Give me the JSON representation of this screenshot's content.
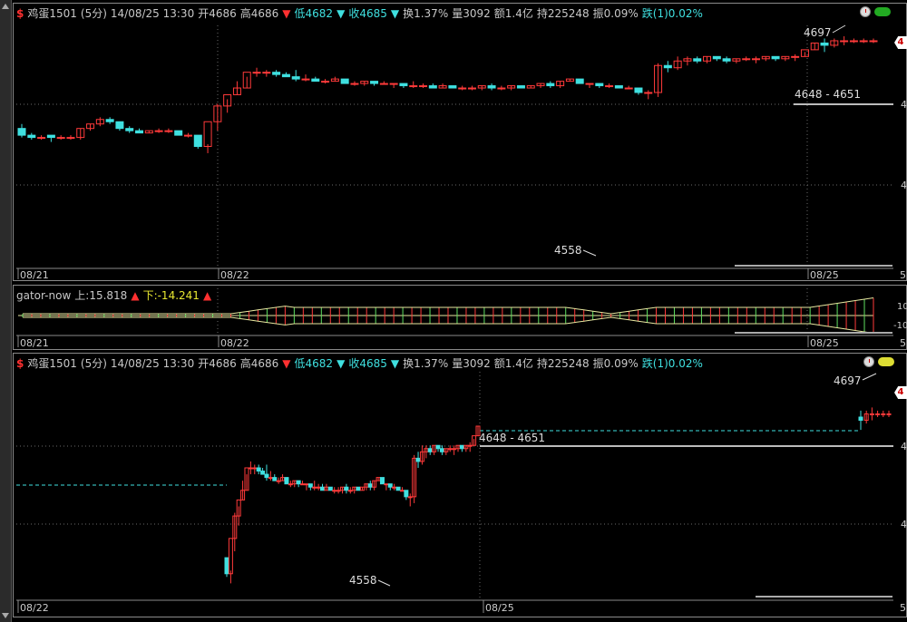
{
  "header": {
    "symbol_mark": "$",
    "name": "鸡蛋1501",
    "period": "(5分)",
    "datetime": "14/08/25 13:30",
    "open": "开4686",
    "high": "高4686",
    "low": "低4682",
    "close": "收4685",
    "turnover": "换1.37%",
    "volume": "量3092",
    "amount": "额1.4亿",
    "open_interest": "持225248",
    "amplitude": "振0.09%",
    "change": "跌(1)0.02%"
  },
  "indicator": {
    "name": "gator-now",
    "upper": "上:15.818",
    "lower": "下:-14.241",
    "scale_top": "10",
    "scale_bottom": "-10"
  },
  "colors": {
    "up": "#ff3a3a",
    "down": "#3fe0e0",
    "grid": "#6a6a6a",
    "bg": "#000000",
    "gator_line": "#e8e8a0",
    "gator_red": "#ff3a3a",
    "gator_green": "#60e060"
  },
  "right_tag": "4",
  "chart_data": [
    {
      "type": "candlestick",
      "title": "鸡蛋1501 (5分)",
      "x_labels": [
        "08/21",
        "08/22",
        "08/25"
      ],
      "right_axis_ticks": [
        "4",
        "4",
        "4"
      ],
      "annotations": {
        "high_label": "4697",
        "low_label": "4558",
        "range_label": "4648 - 4651",
        "right_edge": "5"
      },
      "ohlc_rel": [
        [
          0.59,
          0.61,
          0.55,
          0.56
        ],
        [
          0.56,
          0.57,
          0.54,
          0.55
        ],
        [
          0.55,
          0.56,
          0.54,
          0.55
        ],
        [
          0.56,
          0.56,
          0.53,
          0.55
        ],
        [
          0.55,
          0.56,
          0.54,
          0.55
        ],
        [
          0.55,
          0.56,
          0.54,
          0.55
        ],
        [
          0.55,
          0.59,
          0.54,
          0.59
        ],
        [
          0.59,
          0.61,
          0.58,
          0.61
        ],
        [
          0.61,
          0.64,
          0.6,
          0.63
        ],
        [
          0.63,
          0.64,
          0.61,
          0.62
        ],
        [
          0.62,
          0.62,
          0.58,
          0.59
        ],
        [
          0.59,
          0.6,
          0.57,
          0.58
        ],
        [
          0.58,
          0.59,
          0.57,
          0.57
        ],
        [
          0.57,
          0.58,
          0.57,
          0.58
        ],
        [
          0.58,
          0.59,
          0.57,
          0.58
        ],
        [
          0.58,
          0.59,
          0.57,
          0.58
        ],
        [
          0.58,
          0.58,
          0.56,
          0.56
        ],
        [
          0.56,
          0.57,
          0.55,
          0.56
        ],
        [
          0.56,
          0.56,
          0.5,
          0.51
        ],
        [
          0.51,
          0.52,
          0.48,
          0.62
        ],
        [
          0.62,
          0.7,
          0.58,
          0.69
        ],
        [
          0.69,
          0.72,
          0.66,
          0.74
        ],
        [
          0.74,
          0.8,
          0.74,
          0.77
        ],
        [
          0.77,
          0.82,
          0.77,
          0.84
        ],
        [
          0.84,
          0.86,
          0.82,
          0.84
        ],
        [
          0.84,
          0.85,
          0.82,
          0.84
        ],
        [
          0.84,
          0.85,
          0.82,
          0.83
        ],
        [
          0.83,
          0.84,
          0.82,
          0.82
        ],
        [
          0.82,
          0.85,
          0.8,
          0.81
        ],
        [
          0.81,
          0.83,
          0.8,
          0.81
        ],
        [
          0.81,
          0.82,
          0.8,
          0.8
        ],
        [
          0.8,
          0.81,
          0.79,
          0.8
        ],
        [
          0.8,
          0.82,
          0.8,
          0.81
        ],
        [
          0.81,
          0.81,
          0.79,
          0.79
        ],
        [
          0.79,
          0.8,
          0.78,
          0.79
        ],
        [
          0.79,
          0.8,
          0.78,
          0.8
        ],
        [
          0.8,
          0.8,
          0.78,
          0.79
        ],
        [
          0.79,
          0.8,
          0.79,
          0.79
        ],
        [
          0.79,
          0.79,
          0.77,
          0.79
        ],
        [
          0.79,
          0.79,
          0.77,
          0.78
        ],
        [
          0.78,
          0.8,
          0.77,
          0.78
        ],
        [
          0.78,
          0.79,
          0.77,
          0.78
        ],
        [
          0.78,
          0.79,
          0.77,
          0.77
        ],
        [
          0.77,
          0.79,
          0.77,
          0.78
        ],
        [
          0.78,
          0.78,
          0.77,
          0.77
        ],
        [
          0.77,
          0.78,
          0.76,
          0.77
        ],
        [
          0.77,
          0.78,
          0.76,
          0.77
        ],
        [
          0.77,
          0.78,
          0.76,
          0.78
        ],
        [
          0.78,
          0.79,
          0.76,
          0.77
        ],
        [
          0.77,
          0.78,
          0.76,
          0.77
        ],
        [
          0.77,
          0.78,
          0.76,
          0.78
        ],
        [
          0.78,
          0.78,
          0.77,
          0.77
        ],
        [
          0.77,
          0.78,
          0.77,
          0.78
        ],
        [
          0.78,
          0.79,
          0.77,
          0.79
        ],
        [
          0.79,
          0.8,
          0.77,
          0.78
        ],
        [
          0.78,
          0.8,
          0.77,
          0.8
        ],
        [
          0.8,
          0.81,
          0.8,
          0.81
        ],
        [
          0.81,
          0.81,
          0.79,
          0.79
        ],
        [
          0.79,
          0.79,
          0.77,
          0.79
        ],
        [
          0.79,
          0.79,
          0.77,
          0.78
        ],
        [
          0.78,
          0.79,
          0.77,
          0.78
        ],
        [
          0.78,
          0.78,
          0.77,
          0.77
        ],
        [
          0.77,
          0.78,
          0.77,
          0.77
        ],
        [
          0.77,
          0.77,
          0.74,
          0.75
        ],
        [
          0.75,
          0.76,
          0.72,
          0.75
        ],
        [
          0.75,
          0.88,
          0.73,
          0.87
        ],
        [
          0.87,
          0.89,
          0.84,
          0.86
        ],
        [
          0.86,
          0.91,
          0.85,
          0.89
        ],
        [
          0.89,
          0.91,
          0.87,
          0.9
        ],
        [
          0.9,
          0.91,
          0.88,
          0.89
        ],
        [
          0.89,
          0.91,
          0.88,
          0.91
        ],
        [
          0.91,
          0.91,
          0.89,
          0.9
        ],
        [
          0.9,
          0.91,
          0.88,
          0.89
        ],
        [
          0.89,
          0.9,
          0.88,
          0.9
        ],
        [
          0.9,
          0.91,
          0.89,
          0.9
        ],
        [
          0.9,
          0.91,
          0.88,
          0.9
        ],
        [
          0.9,
          0.91,
          0.89,
          0.91
        ],
        [
          0.91,
          0.91,
          0.89,
          0.9
        ],
        [
          0.9,
          0.91,
          0.89,
          0.91
        ],
        [
          0.91,
          0.92,
          0.89,
          0.91
        ],
        [
          0.91,
          0.93,
          0.91,
          0.94
        ],
        [
          0.94,
          0.97,
          0.94,
          0.97
        ],
        [
          0.97,
          0.99,
          0.93,
          0.96
        ],
        [
          0.96,
          0.99,
          0.95,
          0.98
        ],
        [
          0.98,
          1.0,
          0.96,
          0.98
        ],
        [
          0.98,
          0.99,
          0.97,
          0.98
        ],
        [
          0.98,
          0.99,
          0.97,
          0.98
        ],
        [
          0.98,
          0.99,
          0.97,
          0.98
        ]
      ]
    },
    {
      "type": "bar",
      "title": "gator-now",
      "x_labels": [
        "08/21",
        "08/22",
        "08/25"
      ],
      "series": [
        {
          "name": "上",
          "last_value": 15.818
        },
        {
          "name": "下",
          "last_value": -14.241
        }
      ]
    },
    {
      "type": "candlestick",
      "title": "鸡蛋1501 (5分)",
      "x_labels": [
        "08/22",
        "08/25"
      ],
      "right_axis_ticks": [
        "4",
        "4"
      ],
      "annotations": {
        "high_label": "4697",
        "low_label": "4558",
        "range_label": "4648 - 4651",
        "right_edge": "5"
      }
    }
  ]
}
